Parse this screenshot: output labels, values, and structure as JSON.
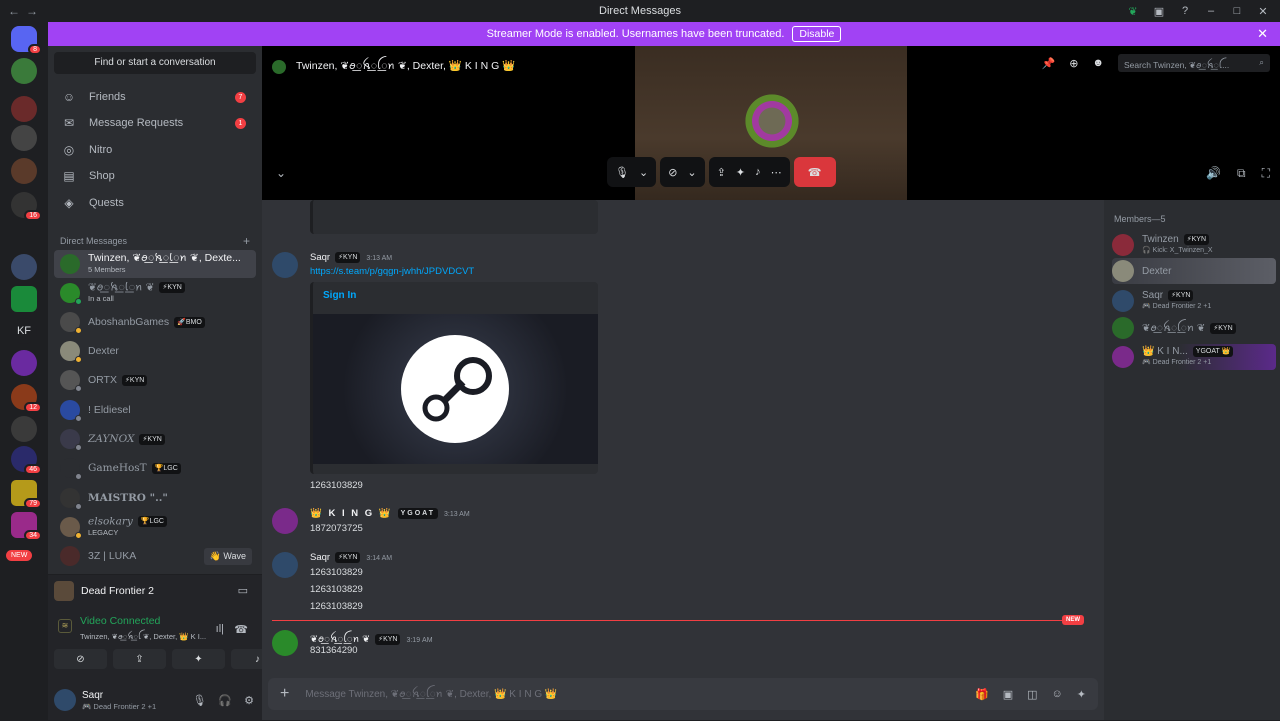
{
  "window": {
    "title": "Direct Messages"
  },
  "banner": {
    "text": "Streamer Mode is enabled. Usernames have been truncated.",
    "disable_label": "Disable",
    "color": "#a142f4"
  },
  "servers": {
    "badges": [
      "8",
      "16",
      "12",
      "46",
      "79",
      "34"
    ],
    "kf_label": "KF",
    "new_label": "NEW"
  },
  "dm_sidebar": {
    "find_placeholder": "Find or start a conversation",
    "nav": [
      {
        "label": "Friends",
        "badge": "7",
        "icon": "friends-icon"
      },
      {
        "label": "Message Requests",
        "badge": "1",
        "icon": "mail-icon"
      },
      {
        "label": "Nitro",
        "badge": "",
        "icon": "nitro-icon"
      },
      {
        "label": "Shop",
        "badge": "",
        "icon": "shop-icon"
      },
      {
        "label": "Quests",
        "badge": "",
        "icon": "quests-icon"
      }
    ],
    "section_label": "Direct Messages",
    "dms": [
      {
        "name": "Twinzen, ❦ꪮ꯭ꫝ꯭ꪶ꯭ꪀ ❦, Dexte...",
        "sub": "5 Members",
        "tag": ""
      },
      {
        "name": "❦ꪮ꯭ꫝ꯭ꪶ꯭ꪀ ❦",
        "sub": "In a call",
        "tag": "⚡KYN"
      },
      {
        "name": "AboshanbGames",
        "sub": "",
        "tag": "🚀BMO"
      },
      {
        "name": "Dexter",
        "sub": "",
        "tag": ""
      },
      {
        "name": "ORTX",
        "sub": "",
        "tag": "⚡KYN"
      },
      {
        "name": "! Eldiesel",
        "sub": "",
        "tag": ""
      },
      {
        "name": "ZAYNOX",
        "sub": "",
        "tag": "⚡KYN"
      },
      {
        "name": "GameHosT",
        "sub": "",
        "tag": "🏆LGC"
      },
      {
        "name": "MAISTRO \"..\"",
        "sub": "",
        "tag": ""
      },
      {
        "name": "elsokary",
        "sub": "LEGACY",
        "tag": "🏆LGC"
      },
      {
        "name": "3Z | LUKA",
        "sub": "",
        "tag": ""
      }
    ],
    "wave_label": "👋 Wave"
  },
  "voice_panel": {
    "game": "Dead Frontier 2",
    "status": "Video Connected",
    "channel": "Twinzen, ❦ꪮ꯭ꫝ꯭ꪶ ❦, Dexter, 👑 K I...",
    "user_name": "Saqr",
    "user_status": "🎮 Dead Frontier 2 +1"
  },
  "call": {
    "title": "Twinzen, ❦ꪮ꯭ꫝ꯭ꪶ꯭ꪀ ❦, Dexter, 👑 K I N G 👑",
    "search_placeholder": "Search Twinzen, ❦ꪮ꯭ꫝ꯭ꪶ..."
  },
  "messages": {
    "link": "https://s.team/p/gqgn-jwhh/JPDVDCVT",
    "embed_title": "Sign In",
    "saqr_name": "Saqr",
    "saqr_tag": "⚡KYN",
    "t1": "3:13 AM",
    "code1": "1263103829",
    "king_name": "👑 K I N G 👑",
    "king_tag": "YGOAT",
    "t2": "3:13 AM",
    "king_msg": "1872073725",
    "t3": "3:14 AM",
    "codes": [
      "1263103829",
      "1263103829",
      "1263103829"
    ],
    "green_name": "❦ꪮ꯭ꫝ꯭ꪶ꯭ꪀ ❦",
    "green_tag": "⚡KYN",
    "t4": "3:19 AM",
    "green_msg": "831364290",
    "new_label": "NEW",
    "composer_placeholder": "Message Twinzen, ❦ꪮ꯭ꫝ꯭ꪶ꯭ꪀ ❦, Dexter, 👑 K I N G 👑"
  },
  "members": {
    "header": "Members—5",
    "list": [
      {
        "name": "Twinzen",
        "tag": "⚡KYN",
        "sub": "🎧 Kick: X_Twinzen_X"
      },
      {
        "name": "Dexter",
        "tag": "",
        "sub": ""
      },
      {
        "name": "Saqr",
        "tag": "⚡KYN",
        "sub": "🎮 Dead Frontier 2 +1"
      },
      {
        "name": "❦ꪮ꯭ꫝ꯭ꪶ꯭ꪀ ❦",
        "tag": "⚡KYN",
        "sub": ""
      },
      {
        "name": "👑 K I N...",
        "tag": "YGOAT 👑",
        "sub": "🎮 Dead Frontier 2 +1"
      }
    ]
  }
}
